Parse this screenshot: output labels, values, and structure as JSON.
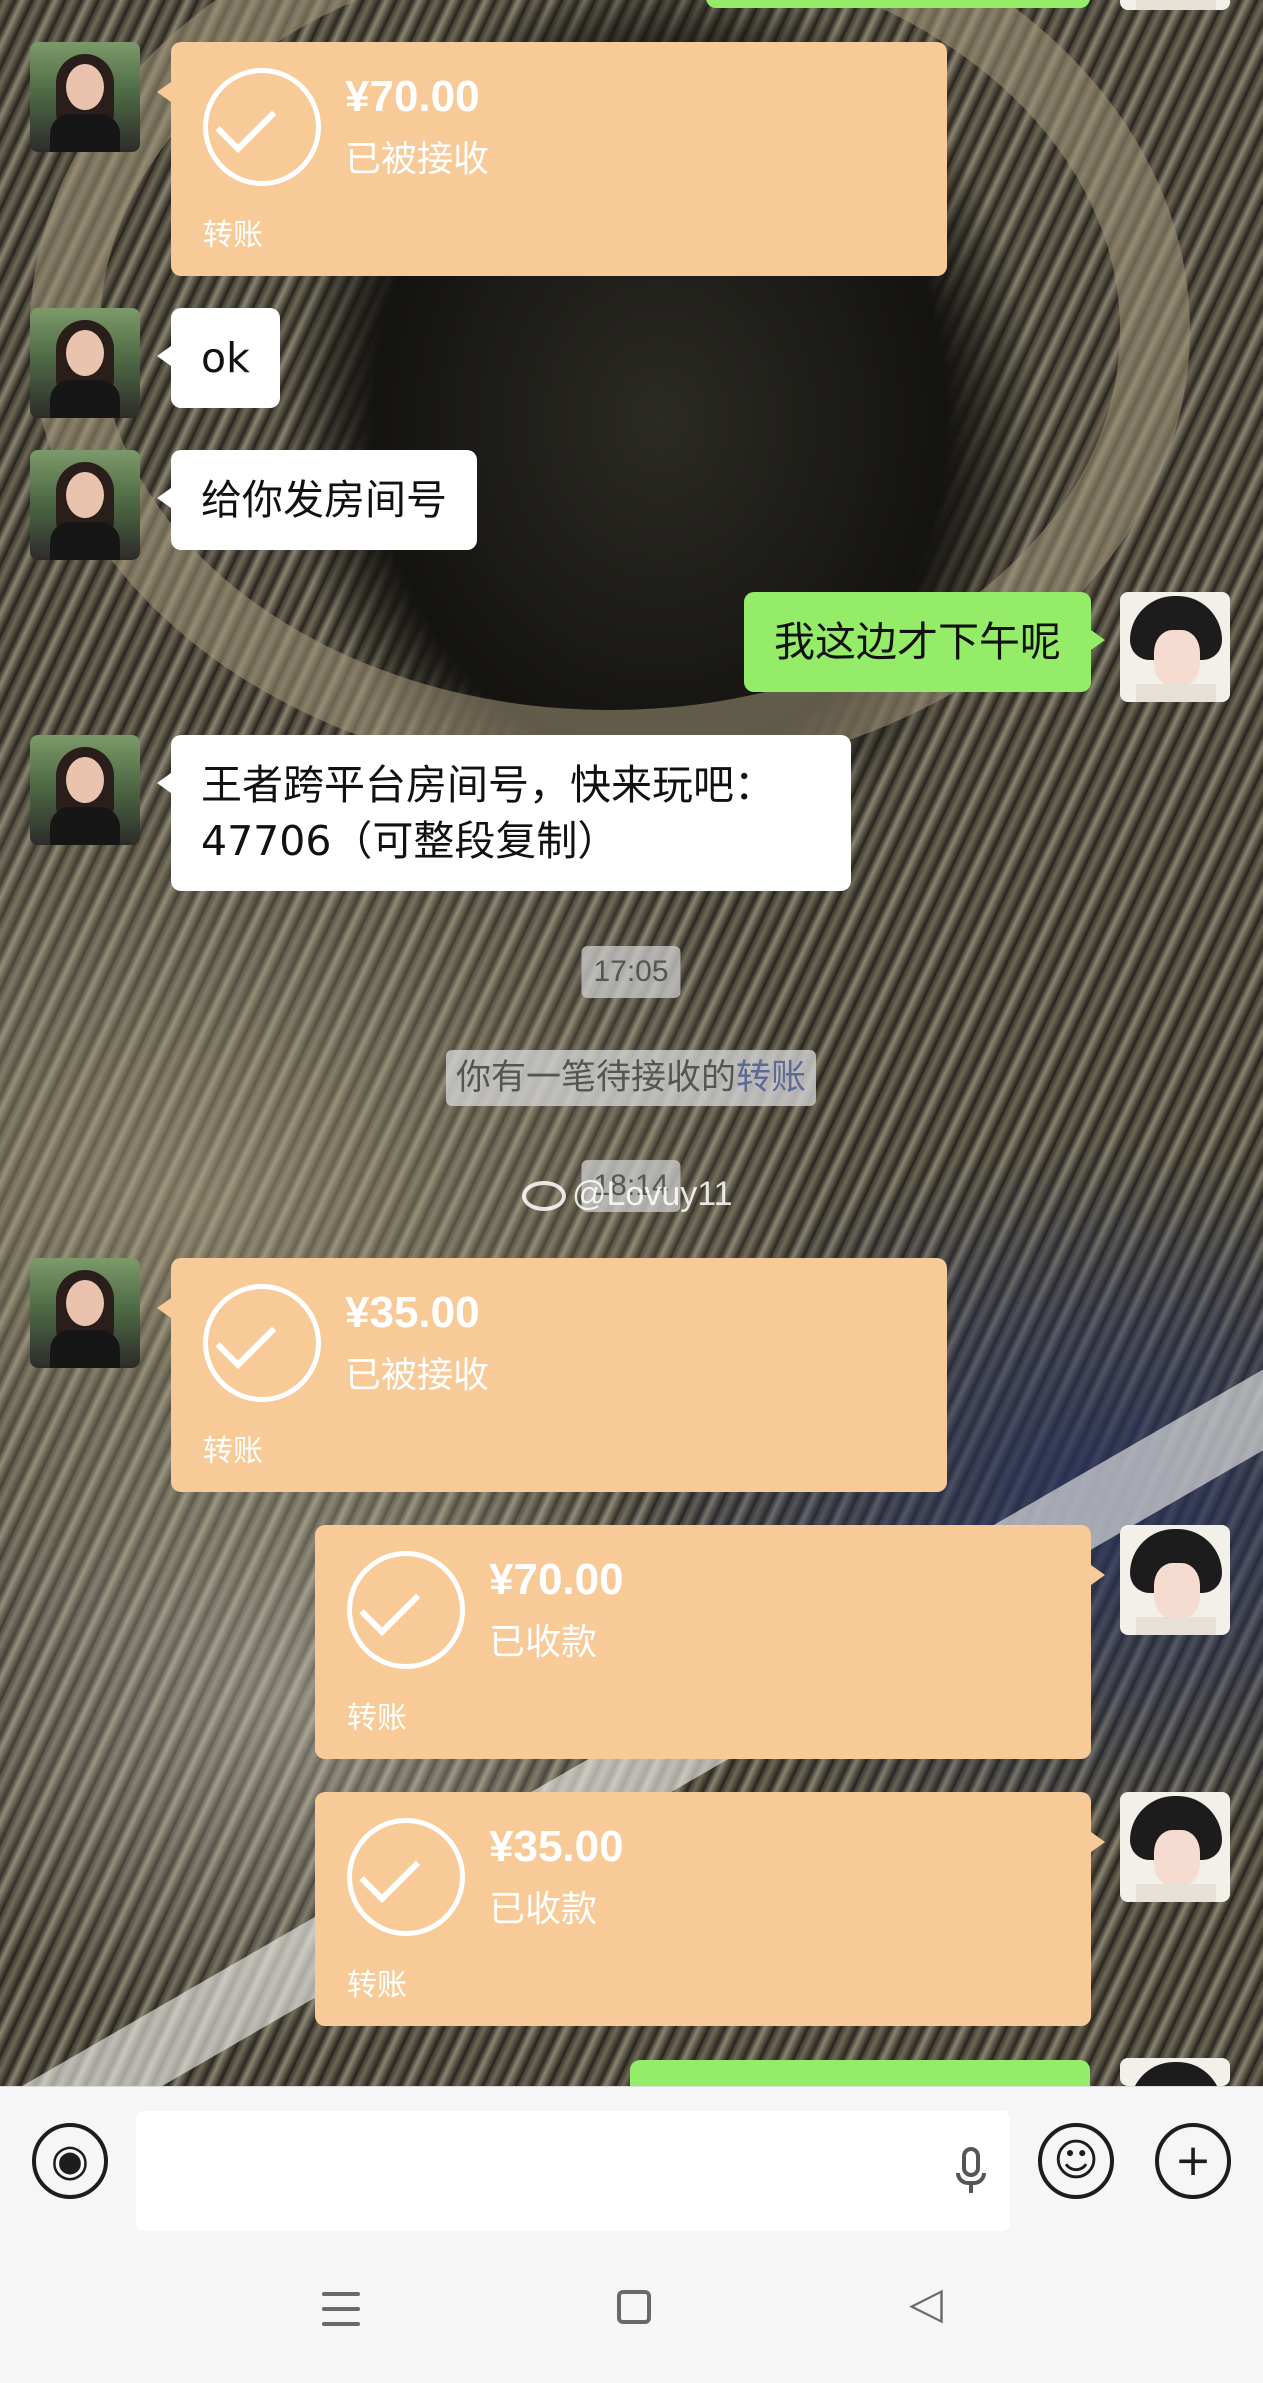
{
  "messages": {
    "transfer_top": {
      "amount": "¥70.00",
      "status": "已被接收",
      "kind": "转账"
    },
    "ok_text": "ok",
    "room_text": "给你发房间号",
    "afternoon_text": "我这边才下午呢",
    "game_room_text": "王者跨平台房间号，快来玩吧：\n47706（可整段复制）",
    "time_1705": "17:05",
    "pending_notice": {
      "prefix": "你有一笔待接收的",
      "link": "转账"
    },
    "time_1814": "18:14",
    "transfer_mid": {
      "amount": "¥35.00",
      "status": "已被接收",
      "kind": "转账"
    },
    "transfer_right_1": {
      "amount": "¥70.00",
      "status": "已收款",
      "kind": "转账"
    },
    "transfer_right_2": {
      "amount": "¥35.00",
      "status": "已收款",
      "kind": "转账"
    }
  },
  "watermark": "@Lovuy11",
  "input_bar": {
    "voice_icon": "voice-wave-icon",
    "mic_icon": "microphone-icon",
    "emoji_icon": "smiley-icon",
    "plus_icon": "plus-icon"
  },
  "nav": {
    "menu_icon": "menu-icon",
    "home_icon": "home-square-icon",
    "back_icon": "back-triangle-icon"
  },
  "colors": {
    "self_bubble": "#95ec69",
    "other_bubble": "#ffffff",
    "transfer": "#f8ca97"
  }
}
